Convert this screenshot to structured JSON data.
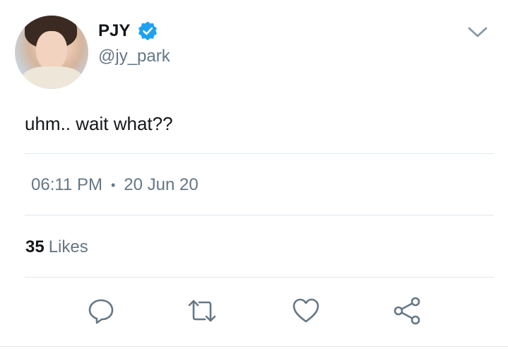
{
  "tweet": {
    "author": {
      "display_name": "PJY",
      "handle": "@jy_park",
      "verified": true
    },
    "text": "uhm.. wait what??",
    "time": "06:11 PM",
    "separator": "•",
    "date": "20 Jun 20",
    "likes": {
      "count": "35",
      "label": "Likes"
    }
  },
  "icons": {
    "verified": "verified-badge-icon",
    "menu": "chevron-down-icon",
    "reply": "reply-icon",
    "retweet": "retweet-icon",
    "like": "heart-icon",
    "share": "share-icon"
  },
  "colors": {
    "verified": "#1da1f2",
    "icon": "#657786",
    "text": "#14171a",
    "muted": "#657786",
    "divider": "#e1e8ed"
  }
}
